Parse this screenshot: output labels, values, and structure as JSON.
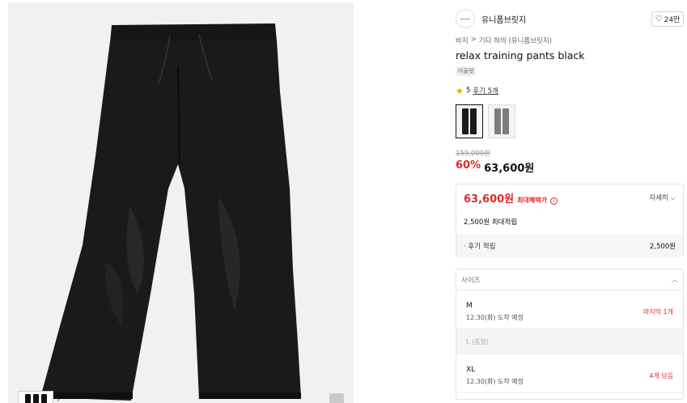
{
  "brand": {
    "name": "유니폼브릿지"
  },
  "like": {
    "count": "24만"
  },
  "breadcrumb": [
    "바지",
    "기타 하의 (유니폼브릿지)"
  ],
  "product": {
    "title": "relax training pants black",
    "tag": "아울렛",
    "rating": "5",
    "review_link": "후기 5개",
    "original_price": "159,000원",
    "discount": "60%",
    "price": "63,600원"
  },
  "swatches": [
    {
      "name": "black",
      "color": "#1b1b1b",
      "selected": true
    },
    {
      "name": "grey",
      "color": "#7d7d7d",
      "selected": false
    }
  ],
  "benefit": {
    "price": "63,600원",
    "label": "최대혜택가",
    "info_icon": "i",
    "detail_link": "자세히",
    "points_summary": "2,500원 최대적립",
    "review_points_label": "· 후기 적립",
    "review_points_value": "2,500원"
  },
  "size_select": {
    "placeholder": "사이즈",
    "options": [
      {
        "size": "M",
        "eta": "12.30(화) 도착 예정",
        "stock": "마지막 1개"
      },
      {
        "size": "L (품절)"
      },
      {
        "size": "XL",
        "eta": "12.30(화) 도착 예정",
        "stock": "4개 남음"
      }
    ]
  },
  "icons": {
    "star": "★",
    "heart": "♡",
    "chevron_right": "›",
    "chevron_down": "⌵",
    "chevron_up": "︿",
    "breadcrumb_sep": ">"
  }
}
